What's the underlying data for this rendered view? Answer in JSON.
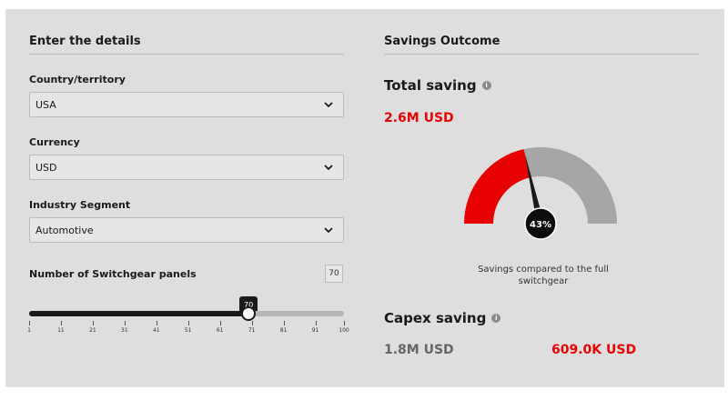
{
  "left": {
    "title": "Enter the details",
    "country": {
      "label": "Country/territory",
      "value": "USA"
    },
    "currency": {
      "label": "Currency",
      "value": "USD"
    },
    "industry": {
      "label": "Industry Segment",
      "value": "Automotive"
    },
    "panels": {
      "label": "Number of Switchgear panels",
      "value": "70",
      "bubble": "70",
      "min": 1,
      "max": 100,
      "current": 70,
      "ticks": [
        "1",
        "11",
        "21",
        "31",
        "41",
        "51",
        "61",
        "71",
        "81",
        "91",
        "100"
      ]
    }
  },
  "right": {
    "title": "Savings Outcome",
    "total_saving": {
      "label": "Total saving",
      "value": "2.6M USD"
    },
    "gauge": {
      "percent_label": "43%",
      "percent": 43,
      "caption": "Savings compared to the full switchgear"
    },
    "capex_saving": {
      "label": "Capex saving",
      "value_grey": "1.8M USD",
      "value_red": "609.0K USD"
    }
  },
  "icons": {
    "info": "info-icon",
    "dropdown": "chevron-down-icon"
  },
  "colors": {
    "accent_red": "#e60000",
    "gauge_grey": "#a6a6a6",
    "panel_bg": "#dedede"
  }
}
